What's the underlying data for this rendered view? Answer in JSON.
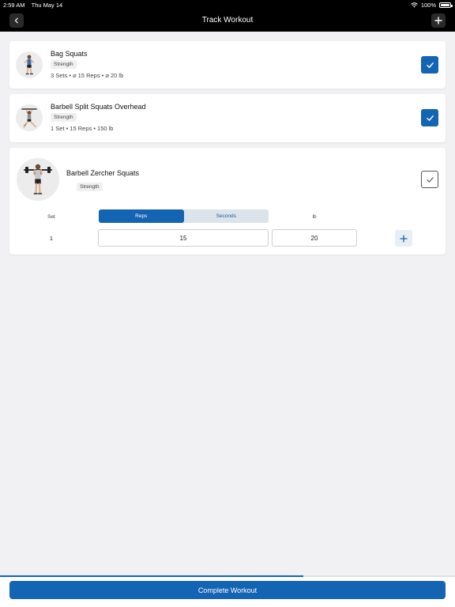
{
  "status_bar": {
    "time": "2:59 AM",
    "date": "Thu May 14",
    "battery": "100%"
  },
  "nav": {
    "title": "Track Workout"
  },
  "exercises": [
    {
      "name": "Bag Squats",
      "tag": "Strength",
      "summary": "3 Sets • ⌀ 15 Reps • ⌀ 20 lb",
      "completed": true
    },
    {
      "name": "Barbell Split Squats Overhead",
      "tag": "Strength",
      "summary": "1 Set • 15 Reps • 150 lb",
      "completed": true
    },
    {
      "name": "Barbell Zercher Squats",
      "tag": "Strength",
      "completed": false,
      "set_header": "Set",
      "mode_options": [
        "Reps",
        "Seconds"
      ],
      "active_mode": "Reps",
      "weight_unit": "lb",
      "sets": [
        {
          "number": "1",
          "reps": "15",
          "weight": "20"
        }
      ]
    }
  ],
  "progress": 0.667,
  "complete_button": "Complete Workout",
  "colors": {
    "accent": "#1464b4",
    "background": "#f1f1f3",
    "header": "#000000"
  }
}
